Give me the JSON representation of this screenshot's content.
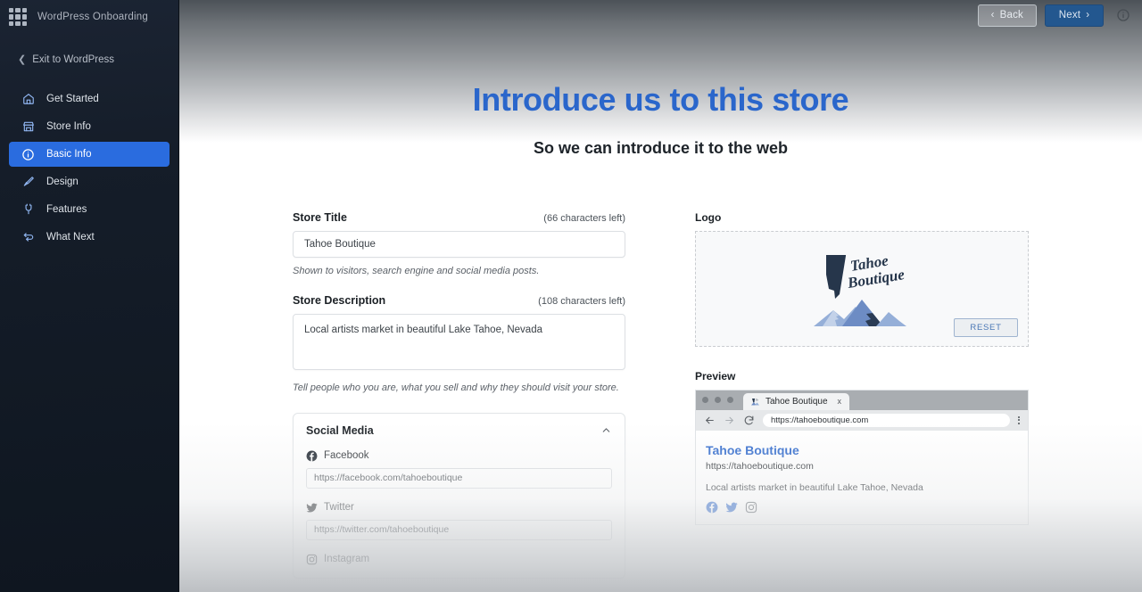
{
  "sidebar": {
    "brand_title": "WordPress Onboarding",
    "grid_icon": "grid-icon",
    "exit_label": "Exit to WordPress",
    "items": [
      {
        "label": "Get Started",
        "icon": "home-icon",
        "active": false
      },
      {
        "label": "Store Info",
        "icon": "store-icon",
        "active": false
      },
      {
        "label": "Basic Info",
        "icon": "info-circle-icon",
        "active": true
      },
      {
        "label": "Design",
        "icon": "paintbrush-icon",
        "active": false
      },
      {
        "label": "Features",
        "icon": "plug-icon",
        "active": false
      },
      {
        "label": "What Next",
        "icon": "arrow-loop-icon",
        "active": false
      }
    ],
    "active_color": "#2a6cdf",
    "background_color": "#151d29"
  },
  "header": {
    "back_label": "Back",
    "back_chevron": "‹",
    "next_label": "Next",
    "next_chevron": "›",
    "info_icon": "info-circle-icon",
    "next_color": "#23578f"
  },
  "hero": {
    "title": "Introduce us to this store",
    "subtitle": "So we can introduce it to the web",
    "title_color": "#2a66cb"
  },
  "form": {
    "store_title": {
      "label": "Store Title",
      "counter": "(66 characters left)",
      "value": "Tahoe Boutique",
      "help": "Shown to visitors, search engine and social media posts."
    },
    "store_description": {
      "label": "Store Description",
      "counter": "(108 characters left)",
      "value": "Local artists market in beautiful Lake Tahoe, Nevada",
      "help": "Tell people who you are, what you sell and why they should visit your store."
    },
    "social": {
      "title": "Social Media",
      "collapse_icon": "chevron-up-icon",
      "networks": [
        {
          "label": "Facebook",
          "icon": "facebook-icon",
          "value": "https://facebook.com/tahoeboutique"
        },
        {
          "label": "Twitter",
          "icon": "twitter-icon",
          "value": "https://twitter.com/tahoeboutique"
        },
        {
          "label": "Instagram",
          "icon": "instagram-icon",
          "value": ""
        }
      ]
    }
  },
  "logo_panel": {
    "label": "Logo",
    "reset_label": "RESET",
    "image_alt": "Tahoe Boutique logo with Nevada state outline and mountains"
  },
  "preview": {
    "label": "Preview",
    "browser": {
      "tab_title": "Tahoe Boutique",
      "tab_close": "x",
      "back_icon": "arrow-left-icon",
      "forward_icon": "arrow-right-icon",
      "reload_icon": "reload-icon",
      "menu_icon": "kebab-menu-icon",
      "url": "https://tahoeboutique.com"
    },
    "result_title": "Tahoe Boutique",
    "result_url": "https://tahoeboutique.com",
    "result_description": "Local artists market in beautiful Lake Tahoe, Nevada",
    "social_icons": [
      "facebook-icon",
      "twitter-icon",
      "instagram-icon"
    ]
  },
  "cursor": {
    "type": "pointer-hand"
  }
}
